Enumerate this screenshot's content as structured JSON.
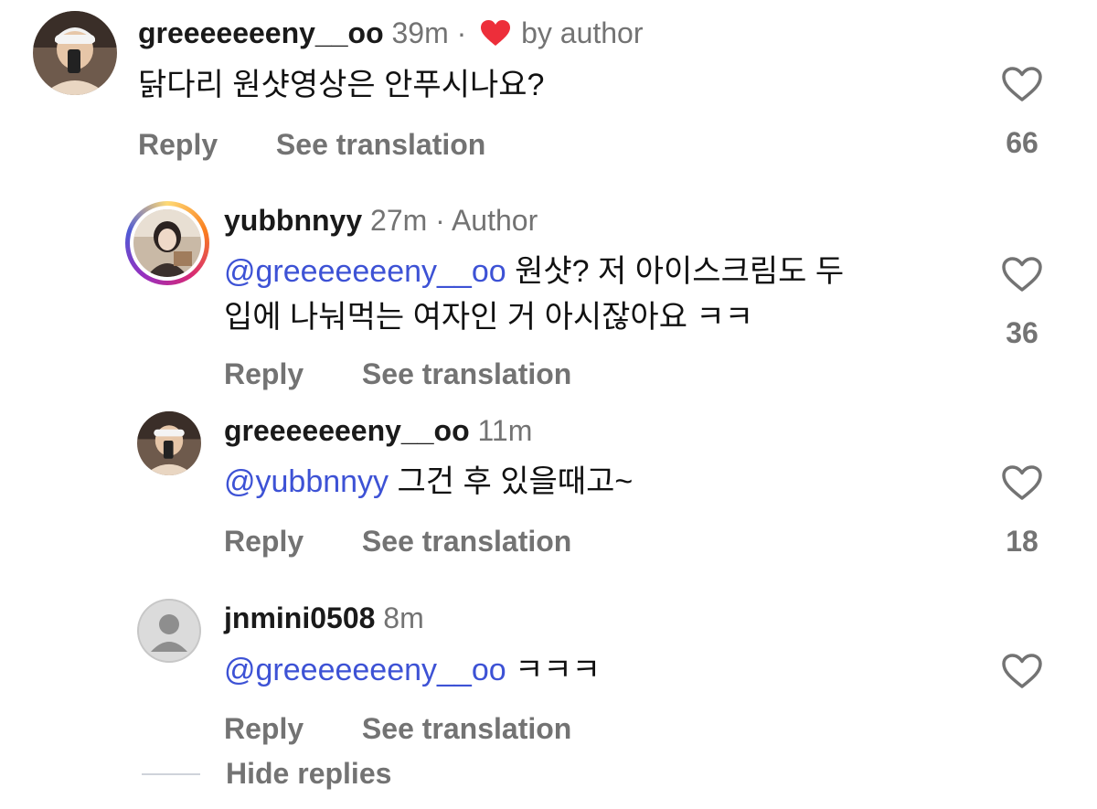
{
  "colors": {
    "mention": "#3d52d5",
    "muted": "#737373",
    "heart": "#ed2e3a"
  },
  "comments": [
    {
      "username": "greeeeeeeny__oo",
      "time": "39m",
      "separator": "·",
      "liked_by_author": "by author",
      "text": "닭다리 원샷영상은 안푸시나요?",
      "reply_label": "Reply",
      "translate_label": "See translation",
      "like_count": "66",
      "avatar_icon": "user-photo-avatar"
    },
    {
      "username": "yubbnnyy",
      "time": "27m",
      "separator": "·",
      "author_tag": "Author",
      "mention": "@greeeeeeeny__oo",
      "text_line1": " 원샷? 저 아이스크림도 두",
      "text_line2": "입에 나눠먹는 여자인 거 아시잖아요 ㅋㅋ",
      "reply_label": "Reply",
      "translate_label": "See translation",
      "like_count": "36",
      "avatar_icon": "story-ring-avatar"
    },
    {
      "username": "greeeeeeeny__oo",
      "time": "11m",
      "mention": "@yubbnnyy",
      "text": " 그건 후 있을때고~",
      "reply_label": "Reply",
      "translate_label": "See translation",
      "like_count": "18",
      "avatar_icon": "user-photo-avatar"
    },
    {
      "username": "jnmini0508",
      "time": "8m",
      "mention": "@greeeeeeeny__oo",
      "text": " ㅋㅋㅋ",
      "reply_label": "Reply",
      "translate_label": "See translation",
      "avatar_icon": "default-person-avatar"
    }
  ],
  "hide_replies_label": "Hide replies"
}
